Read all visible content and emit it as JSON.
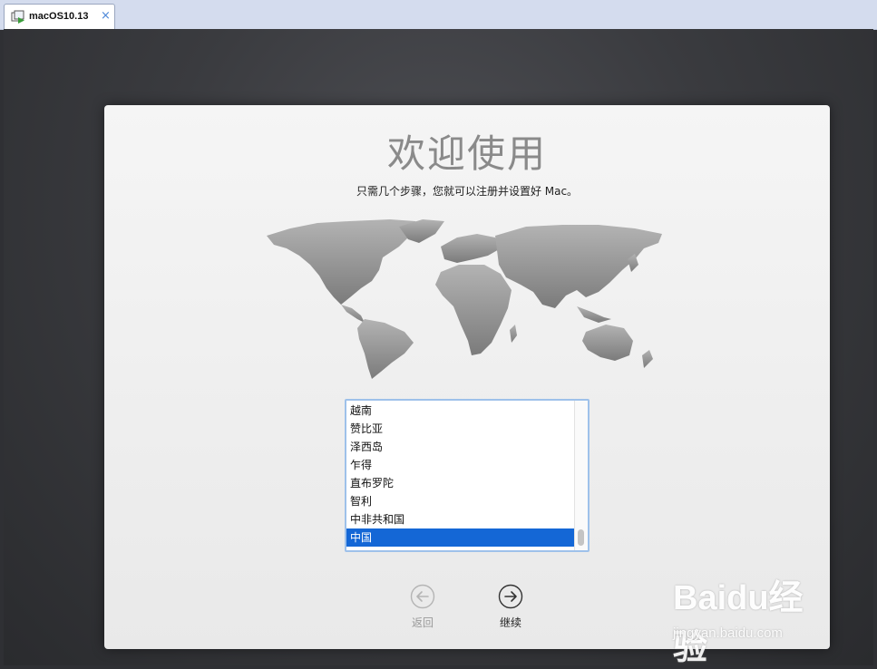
{
  "tabbar": {
    "tab_title": "macOS10.13",
    "tab_icon": "vm-icon",
    "close_icon": "×"
  },
  "setup": {
    "title": "欢迎使用",
    "subtitle": "只需几个步骤，您就可以注册并设置好 Mac。",
    "map_icon": "world-map-icon",
    "countries": [
      "越南",
      "赞比亚",
      "泽西岛",
      "乍得",
      "直布罗陀",
      "智利",
      "中非共和国",
      "中国"
    ],
    "selected_country": "中国",
    "back_label": "返回",
    "continue_label": "继续"
  },
  "watermark": {
    "logo": "Baidu经验",
    "url": "jingyan.baidu.com"
  },
  "colors": {
    "selection": "#1467d6",
    "listbox_border": "#9ec1ea",
    "title_gray": "#8a8a8a"
  }
}
